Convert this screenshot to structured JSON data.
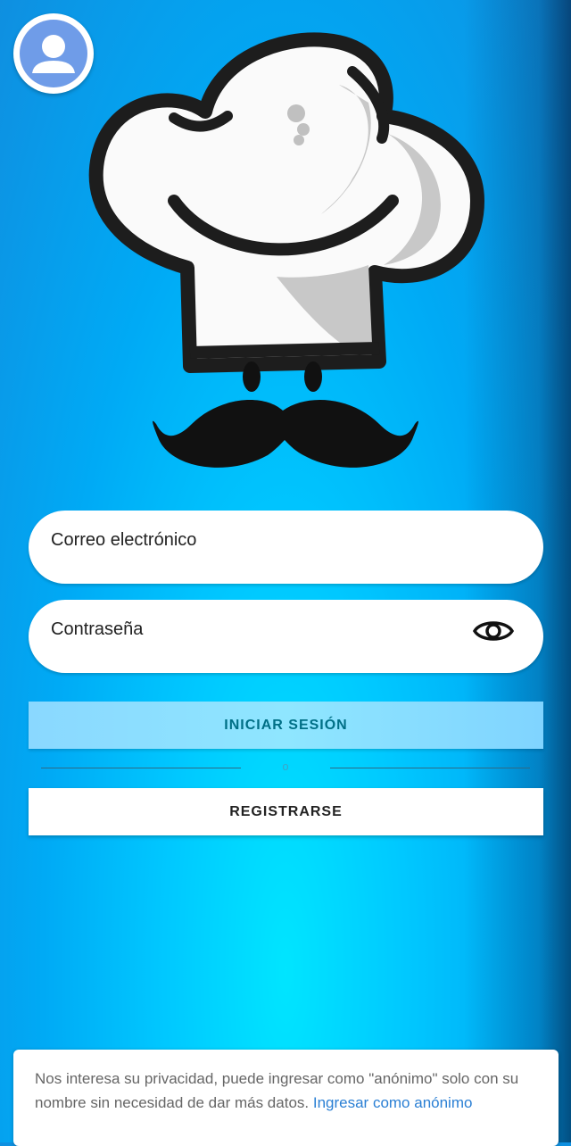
{
  "form": {
    "email_label": "Correo electrónico",
    "password_label": "Contraseña",
    "login_button": "INICIAR SESIÓN",
    "or_text": "o",
    "register_button": "REGISTRARSE"
  },
  "privacy": {
    "message": "Nos interesa su privacidad, puede ingresar como \"anónimo\" solo con su nombre sin necesidad de dar más datos.",
    "link": "Ingresar como anónimo"
  },
  "icons": {
    "avatar": "user-avatar-icon",
    "logo": "chef-hat-mustache-logo",
    "visibility": "eye-icon"
  },
  "colors": {
    "background": "#00b4ff",
    "login_button": "#8fe6ff",
    "link": "#2a7fd4"
  }
}
